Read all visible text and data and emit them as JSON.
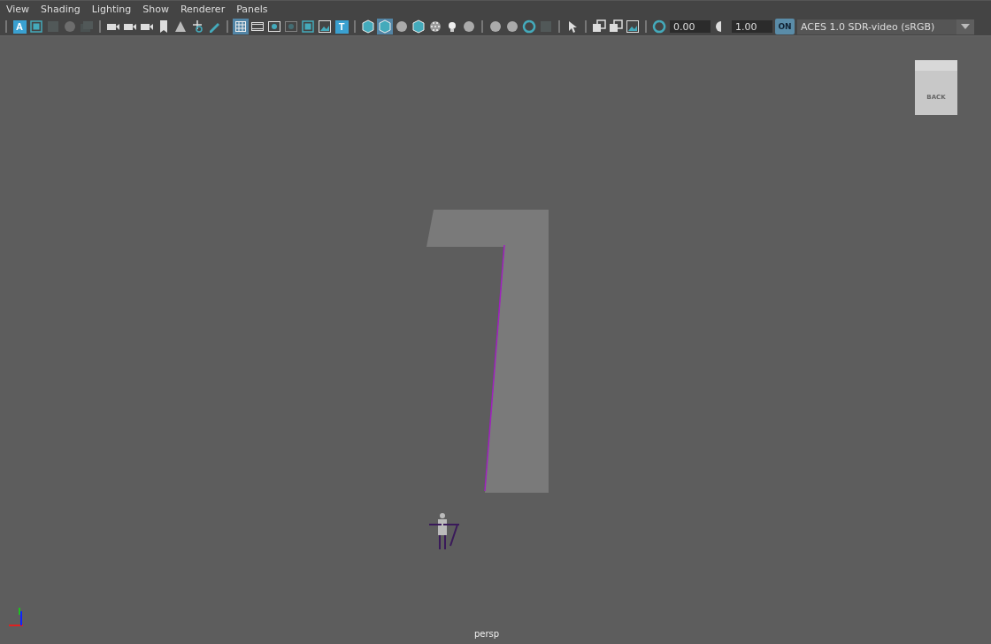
{
  "menu": [
    "View",
    "Shading",
    "Lighting",
    "Show",
    "Renderer",
    "Panels"
  ],
  "toolbar": [
    {
      "kind": "separator"
    },
    {
      "kind": "letter",
      "label": "A",
      "selected": false,
      "disabled": false
    },
    {
      "kind": "frame",
      "selected": false,
      "disabled": false
    },
    {
      "kind": "square",
      "selected": false,
      "disabled": true
    },
    {
      "kind": "sphere",
      "selected": false,
      "disabled": true
    },
    {
      "kind": "layers",
      "selected": false,
      "disabled": true
    },
    {
      "kind": "separator"
    },
    {
      "kind": "camera",
      "selected": false,
      "disabled": false
    },
    {
      "kind": "camera",
      "selected": false,
      "disabled": false
    },
    {
      "kind": "camera",
      "selected": false,
      "disabled": false
    },
    {
      "kind": "bookmark",
      "selected": false,
      "disabled": false
    },
    {
      "kind": "plane",
      "selected": false,
      "disabled": false
    },
    {
      "kind": "move",
      "selected": false,
      "disabled": false
    },
    {
      "kind": "pencil",
      "selected": false,
      "disabled": false
    },
    {
      "kind": "separator"
    },
    {
      "kind": "grid",
      "selected": true,
      "disabled": false
    },
    {
      "kind": "film",
      "selected": false,
      "disabled": false
    },
    {
      "kind": "dot",
      "selected": false,
      "disabled": false
    },
    {
      "kind": "dot",
      "selected": false,
      "disabled": true
    },
    {
      "kind": "frame",
      "selected": false,
      "disabled": false
    },
    {
      "kind": "image",
      "selected": false,
      "disabled": false
    },
    {
      "kind": "letter",
      "label": "T",
      "selected": false,
      "disabled": false
    },
    {
      "kind": "separator"
    },
    {
      "kind": "cube",
      "selected": false,
      "disabled": false
    },
    {
      "kind": "cube",
      "selected": true,
      "disabled": false
    },
    {
      "kind": "sphere",
      "selected": false,
      "disabled": false
    },
    {
      "kind": "cube",
      "selected": false,
      "disabled": false
    },
    {
      "kind": "checker",
      "selected": false,
      "disabled": false
    },
    {
      "kind": "bulb",
      "selected": false,
      "disabled": false
    },
    {
      "kind": "sphere",
      "selected": false,
      "disabled": false
    },
    {
      "kind": "separator"
    },
    {
      "kind": "sphere",
      "selected": false,
      "disabled": false
    },
    {
      "kind": "sphere",
      "selected": false,
      "disabled": false
    },
    {
      "kind": "ring",
      "selected": false,
      "disabled": false
    },
    {
      "kind": "square",
      "selected": false,
      "disabled": true
    },
    {
      "kind": "separator"
    },
    {
      "kind": "cursor",
      "selected": false,
      "disabled": false
    },
    {
      "kind": "separator"
    },
    {
      "kind": "stack",
      "selected": false,
      "disabled": false
    },
    {
      "kind": "stack",
      "selected": false,
      "disabled": false
    },
    {
      "kind": "image",
      "selected": false,
      "disabled": false
    },
    {
      "kind": "separator"
    },
    {
      "kind": "ring",
      "selected": false,
      "disabled": false
    },
    {
      "kind": "field",
      "value": "0.00"
    },
    {
      "kind": "half",
      "selected": false,
      "disabled": false
    },
    {
      "kind": "field",
      "value": "1.00"
    },
    {
      "kind": "toggle",
      "label": "ON",
      "on": true
    },
    {
      "kind": "dropdown",
      "value": "ACES 1.0 SDR-video (sRGB)"
    }
  ],
  "viewcube": {
    "label": "BACK"
  },
  "camera_label": "persp"
}
